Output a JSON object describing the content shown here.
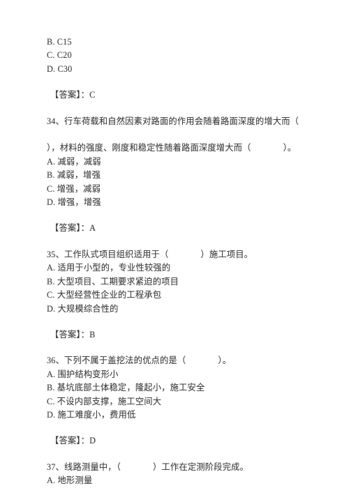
{
  "document": {
    "type": "scanned-exam-paper",
    "language": "zh-CN",
    "text_color": "#3d3d3d",
    "background_color": "#ffffff"
  },
  "carryover_options": {
    "label": "carryover-options-from-previous-question",
    "items": [
      "B. C15",
      "C. C20",
      "D. C30"
    ]
  },
  "answer_label": "【答案】：",
  "items": [
    {
      "id": "answer-carryover",
      "kind": "answer",
      "label": "【答案】：",
      "value": "C",
      "text": "【答案】：C"
    },
    {
      "id": "question-34",
      "kind": "question",
      "number": "34、",
      "stem_line1": "34、行车荷载和自然因素对路面的作用会随着路面深度的增大而（",
      "stem_line2_pre": "），材料的强度、刚度和稳定性随着路面深度增大而（",
      "stem_line2_post": "）。",
      "stem_full": "34、行车荷载和自然因素对路面的作用会随着路面深度的增大而（　），材料的强度、刚度和稳定性随着路面深度增大而（　）。",
      "options": [
        "A. 减弱，减弱",
        "B. 减弱，增强",
        "C. 增强，减弱",
        "D. 增强，增强"
      ]
    },
    {
      "id": "answer-34",
      "kind": "answer",
      "label": "【答案】：",
      "value": "A",
      "text": "【答案】：A"
    },
    {
      "id": "question-35",
      "kind": "question",
      "number": "35、",
      "stem_pre": "35、工作队式项目组织适用于（",
      "stem_post": "）施工项目。",
      "stem_full": "35、工作队式项目组织适用于（　）施工项目。",
      "options": [
        "A. 适用于小型的，专业性较强的",
        "B. 大型项目、工期要求紧迫的项目",
        "C. 大型经营性企业的工程承包",
        "D. 大规模综合性的"
      ]
    },
    {
      "id": "answer-35",
      "kind": "answer",
      "label": "【答案】：",
      "value": "B",
      "text": "【答案】：B"
    },
    {
      "id": "question-36",
      "kind": "question",
      "number": "36、",
      "stem_pre": "36、下列不属于盖挖法的优点的是（",
      "stem_post": "）。",
      "stem_full": "36、下列不属于盖挖法的优点的是（　）。",
      "options": [
        "A. 围护结构变形小",
        "B. 基坑底部土体稳定，隆起小，施工安全",
        "C. 不设内部支撑，施工空间大",
        "D. 施工难度小，费用低"
      ]
    },
    {
      "id": "answer-36",
      "kind": "answer",
      "label": "【答案】：",
      "value": "D",
      "text": "【答案】：D"
    },
    {
      "id": "question-37",
      "kind": "question",
      "number": "37、",
      "stem_pre": "37、线路测量中，（",
      "stem_post": "）工作在定测阶段完成。",
      "stem_full": "37、线路测量中，（　）工作在定测阶段完成。",
      "options": [
        "A. 地形测量"
      ]
    }
  ]
}
